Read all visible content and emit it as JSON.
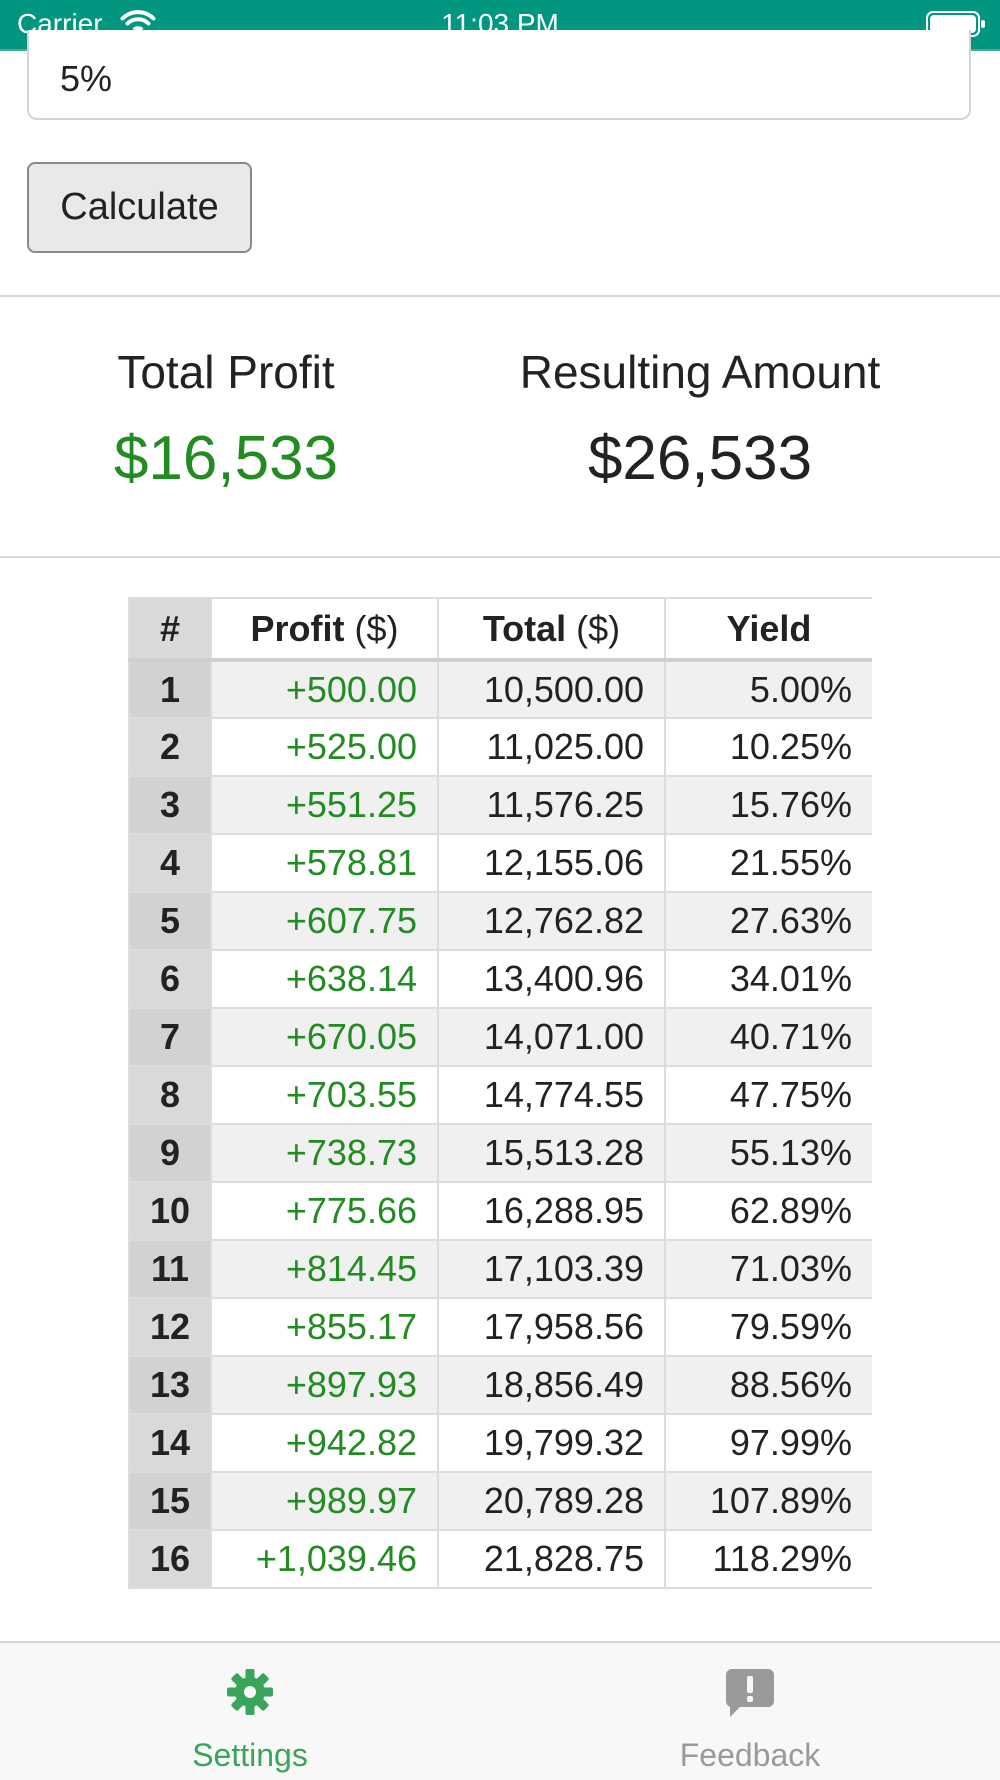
{
  "status_bar": {
    "carrier": "Carrier",
    "time": "11:03 PM"
  },
  "form": {
    "rate_value": "5%",
    "calculate_label": "Calculate"
  },
  "summary": {
    "profit_label": "Total Profit",
    "profit_value": "$16,533",
    "amount_label": "Resulting Amount",
    "amount_value": "$26,533"
  },
  "table": {
    "headers": {
      "index": "#",
      "profit": "Profit",
      "profit_unit": "($)",
      "total": "Total",
      "total_unit": "($)",
      "yield": "Yield"
    },
    "rows": [
      {
        "n": "1",
        "profit": "+500.00",
        "total": "10,500.00",
        "yield": "5.00%"
      },
      {
        "n": "2",
        "profit": "+525.00",
        "total": "11,025.00",
        "yield": "10.25%"
      },
      {
        "n": "3",
        "profit": "+551.25",
        "total": "11,576.25",
        "yield": "15.76%"
      },
      {
        "n": "4",
        "profit": "+578.81",
        "total": "12,155.06",
        "yield": "21.55%"
      },
      {
        "n": "5",
        "profit": "+607.75",
        "total": "12,762.82",
        "yield": "27.63%"
      },
      {
        "n": "6",
        "profit": "+638.14",
        "total": "13,400.96",
        "yield": "34.01%"
      },
      {
        "n": "7",
        "profit": "+670.05",
        "total": "14,071.00",
        "yield": "40.71%"
      },
      {
        "n": "8",
        "profit": "+703.55",
        "total": "14,774.55",
        "yield": "47.75%"
      },
      {
        "n": "9",
        "profit": "+738.73",
        "total": "15,513.28",
        "yield": "55.13%"
      },
      {
        "n": "10",
        "profit": "+775.66",
        "total": "16,288.95",
        "yield": "62.89%"
      },
      {
        "n": "11",
        "profit": "+814.45",
        "total": "17,103.39",
        "yield": "71.03%"
      },
      {
        "n": "12",
        "profit": "+855.17",
        "total": "17,958.56",
        "yield": "79.59%"
      },
      {
        "n": "13",
        "profit": "+897.93",
        "total": "18,856.49",
        "yield": "88.56%"
      },
      {
        "n": "14",
        "profit": "+942.82",
        "total": "19,799.32",
        "yield": "97.99%"
      },
      {
        "n": "15",
        "profit": "+989.97",
        "total": "20,789.28",
        "yield": "107.89%"
      },
      {
        "n": "16",
        "profit": "+1,039.46",
        "total": "21,828.75",
        "yield": "118.29%"
      }
    ]
  },
  "tab_bar": {
    "settings_label": "Settings",
    "feedback_label": "Feedback",
    "active_tab": "settings"
  },
  "colors": {
    "status_bar": "#00967f",
    "positive": "#228b22",
    "tab_active": "#3aa55a",
    "tab_inactive": "#9a9a9a"
  },
  "icons": {
    "settings": "gear-icon",
    "feedback": "feedback-icon",
    "wifi": "wifi-icon",
    "battery": "battery-icon"
  }
}
